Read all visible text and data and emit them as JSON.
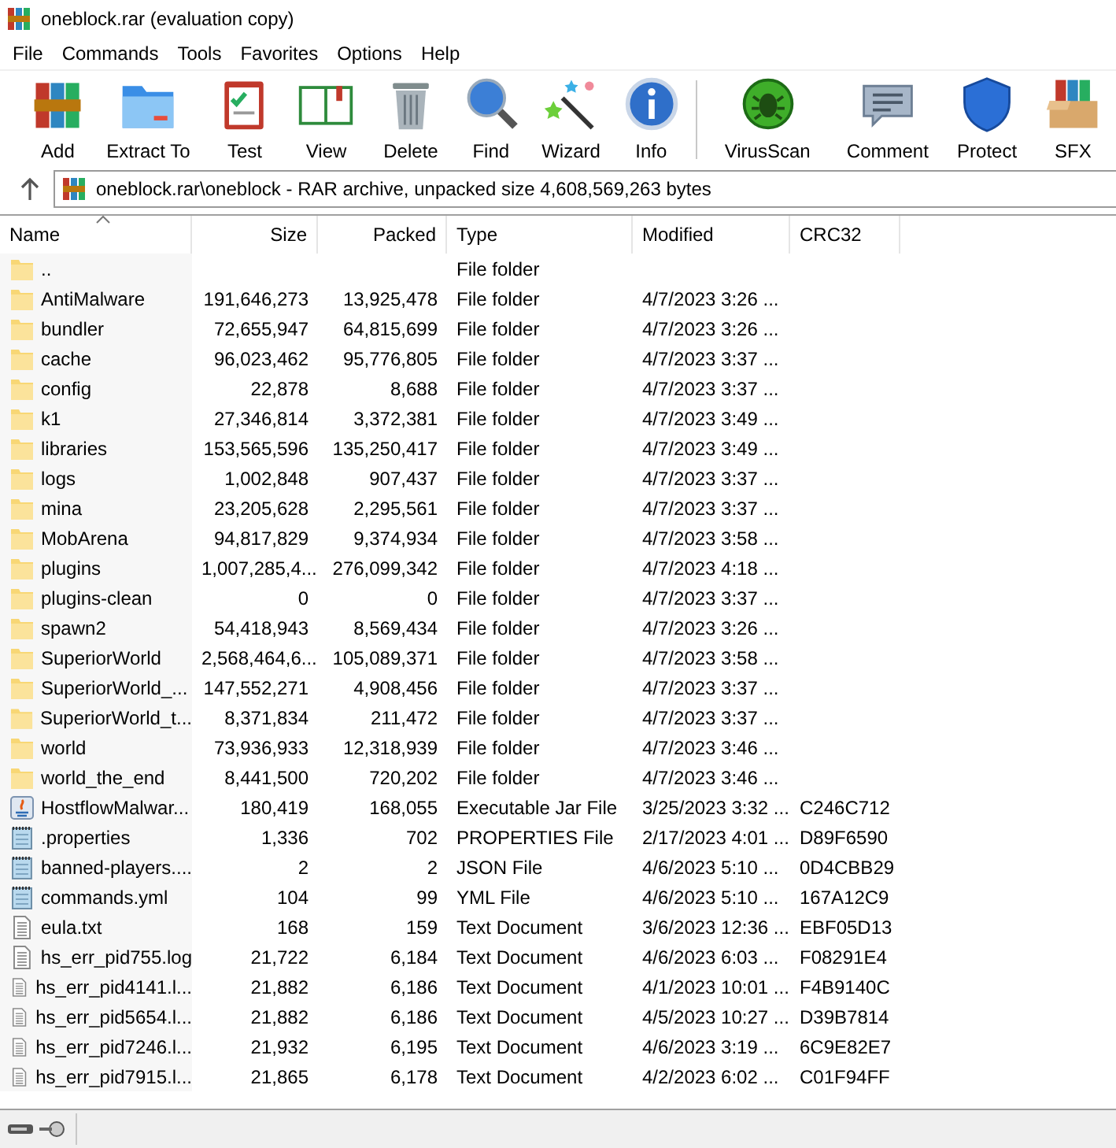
{
  "window": {
    "title": "oneblock.rar (evaluation copy)"
  },
  "menu": [
    "File",
    "Commands",
    "Tools",
    "Favorites",
    "Options",
    "Help"
  ],
  "toolbar": [
    {
      "label": "Add",
      "kind": "books",
      "separator_before": false
    },
    {
      "label": "Extract To",
      "kind": "folder",
      "separator_before": false
    },
    {
      "label": "Test",
      "kind": "clipboard",
      "separator_before": false
    },
    {
      "label": "View",
      "kind": "book",
      "separator_before": false
    },
    {
      "label": "Delete",
      "kind": "trash",
      "separator_before": false
    },
    {
      "label": "Find",
      "kind": "magnifier",
      "separator_before": false
    },
    {
      "label": "Wizard",
      "kind": "wand",
      "separator_before": false
    },
    {
      "label": "Info",
      "kind": "info",
      "separator_before": false
    },
    {
      "label": "VirusScan",
      "kind": "bug",
      "separator_before": true
    },
    {
      "label": "Comment",
      "kind": "speech",
      "separator_before": false
    },
    {
      "label": "Protect",
      "kind": "shield",
      "separator_before": false
    },
    {
      "label": "SFX",
      "kind": "box",
      "separator_before": false
    }
  ],
  "address": {
    "path": "oneblock.rar\\oneblock - RAR archive, unpacked size 4,608,569,263 bytes"
  },
  "table": {
    "columns": [
      {
        "label": "Name",
        "sorted": true
      },
      {
        "label": "Size",
        "sorted": false
      },
      {
        "label": "Packed",
        "sorted": false
      },
      {
        "label": "Type",
        "sorted": false
      },
      {
        "label": "Modified",
        "sorted": false
      },
      {
        "label": "CRC32",
        "sorted": false
      }
    ],
    "rows": [
      {
        "kind": "folder",
        "cells": [
          "..",
          "",
          "",
          "File folder",
          "",
          ""
        ]
      },
      {
        "kind": "folder",
        "cells": [
          "AntiMalware",
          "191,646,273",
          "13,925,478",
          "File folder",
          "4/7/2023 3:26 ...",
          ""
        ]
      },
      {
        "kind": "folder",
        "cells": [
          "bundler",
          "72,655,947",
          "64,815,699",
          "File folder",
          "4/7/2023 3:26 ...",
          ""
        ]
      },
      {
        "kind": "folder",
        "cells": [
          "cache",
          "96,023,462",
          "95,776,805",
          "File folder",
          "4/7/2023 3:37 ...",
          ""
        ]
      },
      {
        "kind": "folder",
        "cells": [
          "config",
          "22,878",
          "8,688",
          "File folder",
          "4/7/2023 3:37 ...",
          ""
        ]
      },
      {
        "kind": "folder",
        "cells": [
          "k1",
          "27,346,814",
          "3,372,381",
          "File folder",
          "4/7/2023 3:49 ...",
          ""
        ]
      },
      {
        "kind": "folder",
        "cells": [
          "libraries",
          "153,565,596",
          "135,250,417",
          "File folder",
          "4/7/2023 3:49 ...",
          ""
        ]
      },
      {
        "kind": "folder",
        "cells": [
          "logs",
          "1,002,848",
          "907,437",
          "File folder",
          "4/7/2023 3:37 ...",
          ""
        ]
      },
      {
        "kind": "folder",
        "cells": [
          "mina",
          "23,205,628",
          "2,295,561",
          "File folder",
          "4/7/2023 3:37 ...",
          ""
        ]
      },
      {
        "kind": "folder",
        "cells": [
          "MobArena",
          "94,817,829",
          "9,374,934",
          "File folder",
          "4/7/2023 3:58 ...",
          ""
        ]
      },
      {
        "kind": "folder",
        "cells": [
          "plugins",
          "1,007,285,4...",
          "276,099,342",
          "File folder",
          "4/7/2023 4:18 ...",
          ""
        ]
      },
      {
        "kind": "folder",
        "cells": [
          "plugins-clean",
          "0",
          "0",
          "File folder",
          "4/7/2023 3:37 ...",
          ""
        ]
      },
      {
        "kind": "folder",
        "cells": [
          "spawn2",
          "54,418,943",
          "8,569,434",
          "File folder",
          "4/7/2023 3:26 ...",
          ""
        ]
      },
      {
        "kind": "folder",
        "cells": [
          "SuperiorWorld",
          "2,568,464,6...",
          "105,089,371",
          "File folder",
          "4/7/2023 3:58 ...",
          ""
        ]
      },
      {
        "kind": "folder",
        "cells": [
          "SuperiorWorld_...",
          "147,552,271",
          "4,908,456",
          "File folder",
          "4/7/2023 3:37 ...",
          ""
        ]
      },
      {
        "kind": "folder",
        "cells": [
          "SuperiorWorld_t...",
          "8,371,834",
          "211,472",
          "File folder",
          "4/7/2023 3:37 ...",
          ""
        ]
      },
      {
        "kind": "folder",
        "cells": [
          "world",
          "73,936,933",
          "12,318,939",
          "File folder",
          "4/7/2023 3:46 ...",
          ""
        ]
      },
      {
        "kind": "folder",
        "cells": [
          "world_the_end",
          "8,441,500",
          "720,202",
          "File folder",
          "4/7/2023 3:46 ...",
          ""
        ]
      },
      {
        "kind": "jar",
        "cells": [
          "HostflowMalwar...",
          "180,419",
          "168,055",
          "Executable Jar File",
          "3/25/2023 3:32 ...",
          "C246C712"
        ]
      },
      {
        "kind": "notepad",
        "cells": [
          ".properties",
          "1,336",
          "702",
          "PROPERTIES File",
          "2/17/2023 4:01 ...",
          "D89F6590"
        ]
      },
      {
        "kind": "notepad",
        "cells": [
          "banned-players....",
          "2",
          "2",
          "JSON File",
          "4/6/2023 5:10 ...",
          "0D4CBB29"
        ]
      },
      {
        "kind": "notepad",
        "cells": [
          "commands.yml",
          "104",
          "99",
          "YML File",
          "4/6/2023 5:10 ...",
          "167A12C9"
        ]
      },
      {
        "kind": "text",
        "cells": [
          "eula.txt",
          "168",
          "159",
          "Text Document",
          "3/6/2023 12:36 ...",
          "EBF05D13"
        ]
      },
      {
        "kind": "text",
        "cells": [
          "hs_err_pid755.log",
          "21,722",
          "6,184",
          "Text Document",
          "4/6/2023 6:03 ...",
          "F08291E4"
        ]
      },
      {
        "kind": "text",
        "cells": [
          "hs_err_pid4141.l...",
          "21,882",
          "6,186",
          "Text Document",
          "4/1/2023 10:01 ...",
          "F4B9140C"
        ]
      },
      {
        "kind": "text",
        "cells": [
          "hs_err_pid5654.l...",
          "21,882",
          "6,186",
          "Text Document",
          "4/5/2023 10:27 ...",
          "D39B7814"
        ]
      },
      {
        "kind": "text",
        "cells": [
          "hs_err_pid7246.l...",
          "21,932",
          "6,195",
          "Text Document",
          "4/6/2023 3:19 ...",
          "6C9E82E7"
        ]
      },
      {
        "kind": "text",
        "cells": [
          "hs_err_pid7915.l...",
          "21,865",
          "6,178",
          "Text Document",
          "4/2/2023 6:02 ...",
          "C01F94FF"
        ]
      }
    ]
  }
}
